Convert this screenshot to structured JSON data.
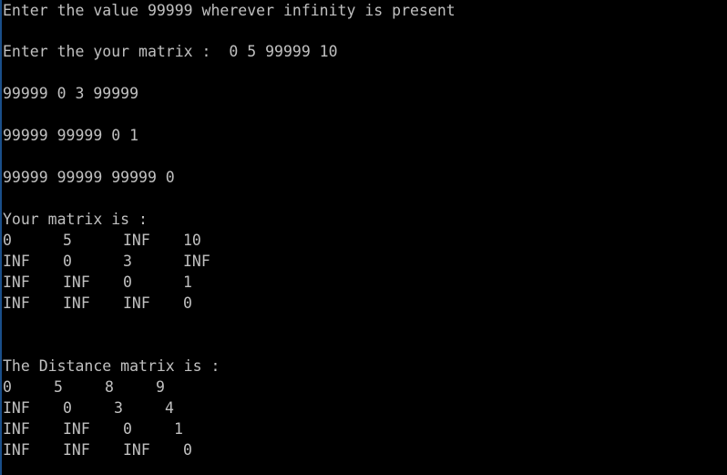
{
  "console": {
    "prompt_infinity": "Enter the value 99999 wherever infinity is present",
    "matrix_input_prompt": "Enter the your matrix :  0 5 99999 10",
    "input_rows": [
      "99999 0 3 99999",
      "99999 99999 0 1",
      "99999 99999 99999 0"
    ],
    "your_matrix_heading": "Your matrix is :",
    "your_matrix": [
      [
        "0",
        "5",
        "INF",
        "10"
      ],
      [
        "INF",
        "0",
        "3",
        "INF"
      ],
      [
        "INF",
        "INF",
        "0",
        "1"
      ],
      [
        "INF",
        "INF",
        "INF",
        "0"
      ]
    ],
    "distance_heading": "The Distance matrix is :",
    "distance_matrix": [
      [
        "0",
        "5",
        "8",
        "9"
      ],
      [
        "INF",
        "0",
        "3",
        "4"
      ],
      [
        "INF",
        "INF",
        "0",
        "1"
      ],
      [
        "INF",
        "INF",
        "INF",
        "0"
      ]
    ]
  }
}
